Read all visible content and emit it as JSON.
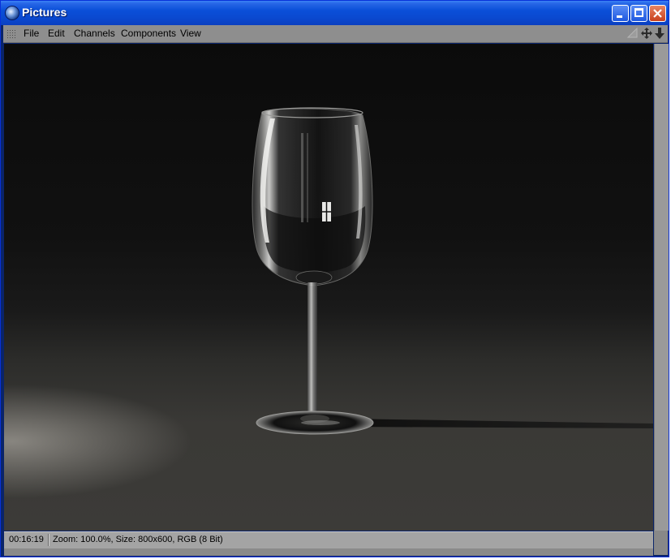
{
  "window": {
    "title": "Pictures",
    "controls": [
      "minimize-icon",
      "maximize-icon",
      "close-icon"
    ]
  },
  "menubar": {
    "items": [
      {
        "label": "File"
      },
      {
        "label": "Edit"
      },
      {
        "label": "Channels"
      },
      {
        "label": "Components"
      },
      {
        "label": "View"
      }
    ],
    "tools": [
      "navigate-arrow-icon",
      "move-icon",
      "download-arrow-icon"
    ]
  },
  "viewport": {
    "image": "wine-glass-render"
  },
  "status": {
    "time": "00:16:19",
    "info": "Zoom: 100.0%, Size: 800x600, RGB (8 Bit)"
  }
}
